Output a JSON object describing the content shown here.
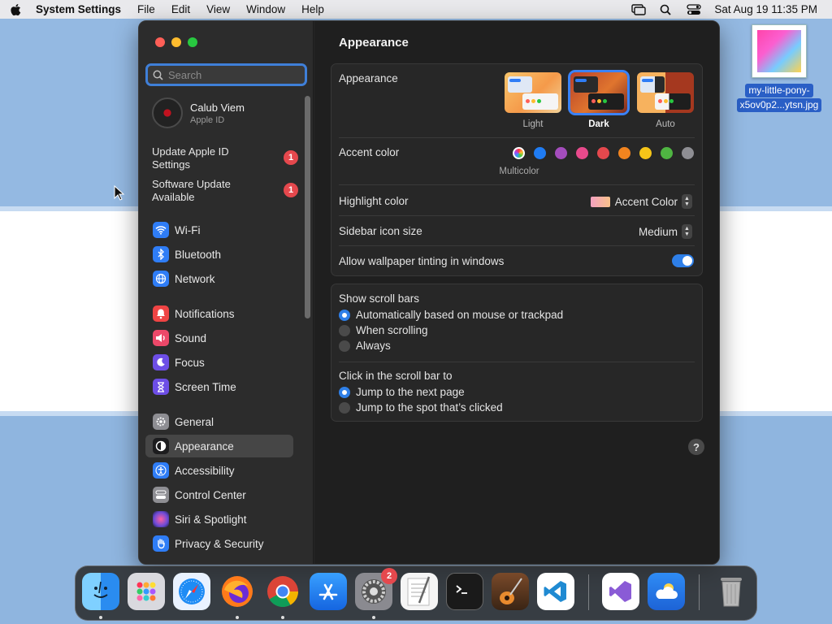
{
  "menubar": {
    "app_name": "System Settings",
    "menus": [
      "File",
      "Edit",
      "View",
      "Window",
      "Help"
    ],
    "clock": "Sat Aug 19  11:35 PM",
    "icons": [
      "apple-icon",
      "screen-mirroring-icon",
      "spotlight-search-icon",
      "control-center-icon"
    ]
  },
  "desktop": {
    "file_label_line1": "my-little-pony-",
    "file_label_line2": "x5ov0p2...ytsn.jpg"
  },
  "sidebar": {
    "search_placeholder": "Search",
    "account_name": "Calub Viem",
    "account_sub": "Apple ID",
    "notices": [
      {
        "label": "Update Apple ID Settings",
        "badge": "1"
      },
      {
        "label": "Software Update Available",
        "badge": "1"
      }
    ],
    "items": [
      {
        "label": "Wi-Fi",
        "icon": "wifi-icon",
        "color": "#2f7df6"
      },
      {
        "label": "Bluetooth",
        "icon": "bluetooth-icon",
        "color": "#2f7df6"
      },
      {
        "label": "Network",
        "icon": "network-globe-icon",
        "color": "#2f7df6"
      },
      {
        "label": "Notifications",
        "icon": "notifications-bell-icon",
        "color": "#ef4444"
      },
      {
        "label": "Sound",
        "icon": "sound-speaker-icon",
        "color": "#ec4869"
      },
      {
        "label": "Focus",
        "icon": "focus-moon-icon",
        "color": "#6d4ee6"
      },
      {
        "label": "Screen Time",
        "icon": "screen-time-hourglass-icon",
        "color": "#6d4ee6"
      },
      {
        "label": "General",
        "icon": "general-gear-icon",
        "color": "#8e8e93"
      },
      {
        "label": "Appearance",
        "icon": "appearance-icon",
        "color": "#1c1c1e"
      },
      {
        "label": "Accessibility",
        "icon": "accessibility-icon",
        "color": "#2f7df6"
      },
      {
        "label": "Control Center",
        "icon": "control-center-icon",
        "color": "#8e8e93"
      },
      {
        "label": "Siri & Spotlight",
        "icon": "siri-icon",
        "color": "#6b4bd8"
      },
      {
        "label": "Privacy & Security",
        "icon": "privacy-hand-icon",
        "color": "#2f7df6"
      }
    ],
    "selected": "Appearance"
  },
  "main": {
    "title": "Appearance",
    "appearance_label": "Appearance",
    "themes": [
      {
        "label": "Light",
        "selected": false
      },
      {
        "label": "Dark",
        "selected": true
      },
      {
        "label": "Auto",
        "selected": false
      }
    ],
    "accent_label": "Accent color",
    "accent_colors": [
      "multicolor",
      "#1f7cf3",
      "#a44dbd",
      "#e84a8c",
      "#e5484d",
      "#f2841f",
      "#f5c518",
      "#4fb542",
      "#8e8e93"
    ],
    "accent_selected_label": "Multicolor",
    "highlight_label": "Highlight color",
    "highlight_value": "Accent Color",
    "icon_size_label": "Sidebar icon size",
    "icon_size_value": "Medium",
    "tinting_label": "Allow wallpaper tinting in windows",
    "tinting_on": true,
    "scroll_bars_label": "Show scroll bars",
    "scroll_bars_options": [
      {
        "label": "Automatically based on mouse or trackpad",
        "selected": true
      },
      {
        "label": "When scrolling",
        "selected": false
      },
      {
        "label": "Always",
        "selected": false
      }
    ],
    "click_label": "Click in the scroll bar to",
    "click_options": [
      {
        "label": "Jump to the next page",
        "selected": true
      },
      {
        "label": "Jump to the spot that’s clicked",
        "selected": false
      }
    ],
    "help": "?"
  },
  "dock": {
    "apps": [
      {
        "name": "Finder",
        "running": true
      },
      {
        "name": "Launchpad",
        "running": false
      },
      {
        "name": "Safari",
        "running": false
      },
      {
        "name": "Firefox",
        "running": true
      },
      {
        "name": "Chrome",
        "running": true
      },
      {
        "name": "App Store",
        "running": false
      },
      {
        "name": "System Settings",
        "running": true,
        "badge": "2"
      },
      {
        "name": "TextEdit",
        "running": false
      },
      {
        "name": "Terminal",
        "running": false
      },
      {
        "name": "GarageBand",
        "running": false
      },
      {
        "name": "Visual Studio Code",
        "running": false
      },
      {
        "name": "Visual Studio",
        "running": false
      },
      {
        "name": "Weather",
        "running": false
      },
      {
        "name": "Trash",
        "running": false
      }
    ]
  }
}
